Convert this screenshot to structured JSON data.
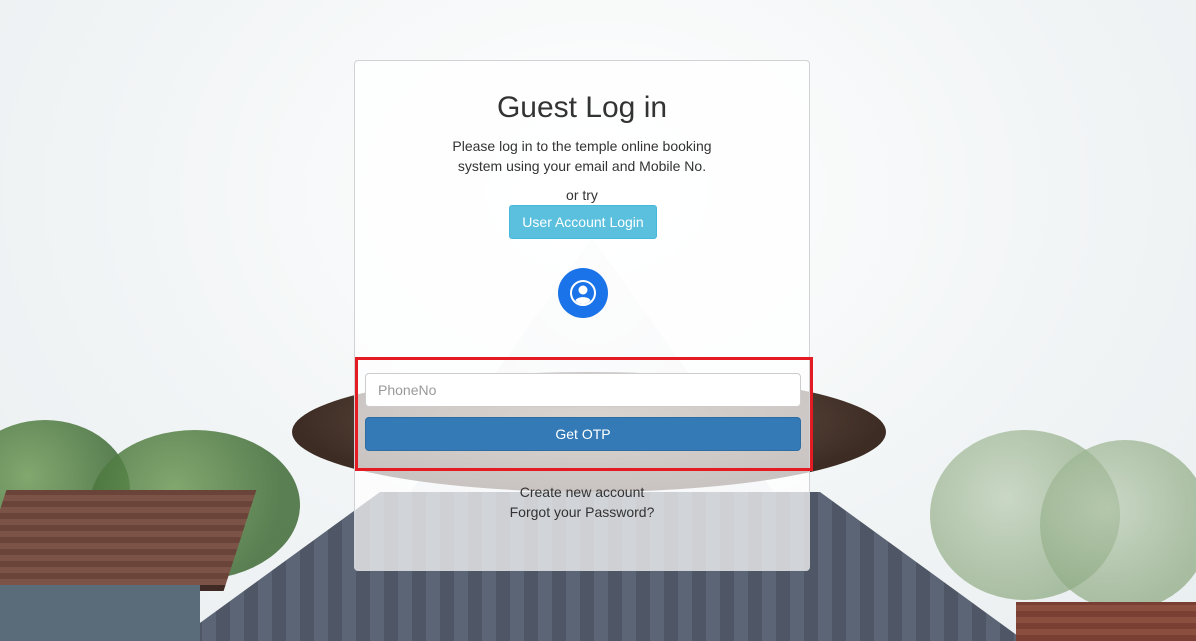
{
  "login": {
    "title": "Guest Log in",
    "description_line1": "Please log in to the temple online booking",
    "description_line2": "system using your email and Mobile No.",
    "or_try": "or try",
    "user_account_button": "User Account Login",
    "avatar_icon": "user-circle-icon",
    "phone_placeholder": "PhoneNo",
    "phone_value": "",
    "get_otp_button": "Get OTP",
    "create_account_link": "Create new account",
    "forgot_password_link": "Forgot your Password?"
  },
  "colors": {
    "info_button": "#5bc0de",
    "primary_button": "#337ab7",
    "avatar": "#1a73e8",
    "highlight_border": "#e41b23"
  }
}
